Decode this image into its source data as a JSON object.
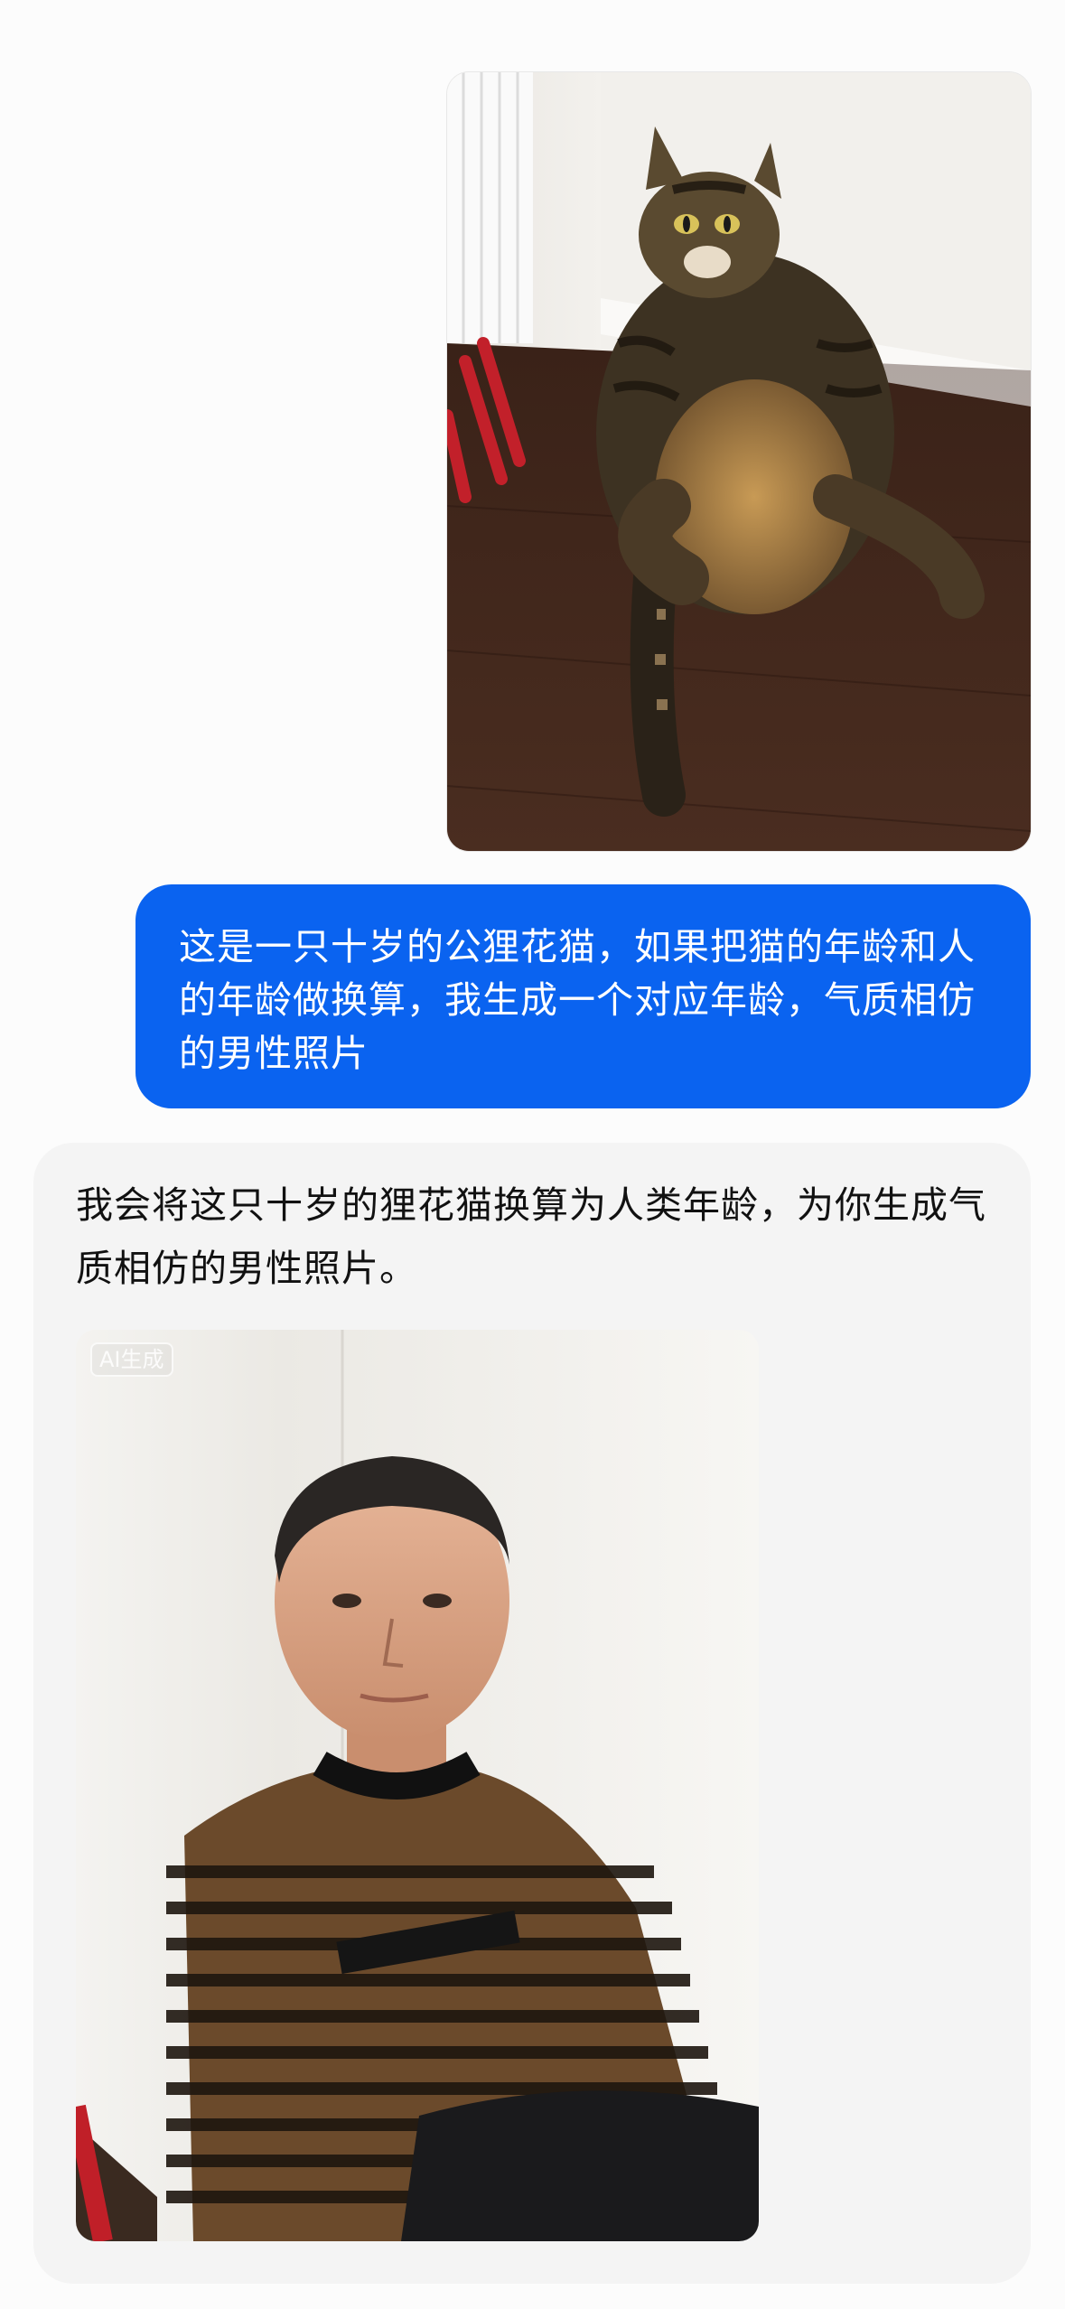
{
  "messages": {
    "user_text": "这是一只十岁的公狸花猫，如果把猫的年龄和人的年龄做换算，我生成一个对应年龄，气质相仿的男性照片",
    "assistant_text": "我会将这只十岁的狸花猫换算为人类年龄，为你生成气质相仿的男性照片。",
    "assistant_image_badge": "AI生成"
  },
  "colors": {
    "user_bubble": "#0a63f0",
    "assistant_card": "#f4f4f4",
    "page_background": "#fcfcfc"
  }
}
